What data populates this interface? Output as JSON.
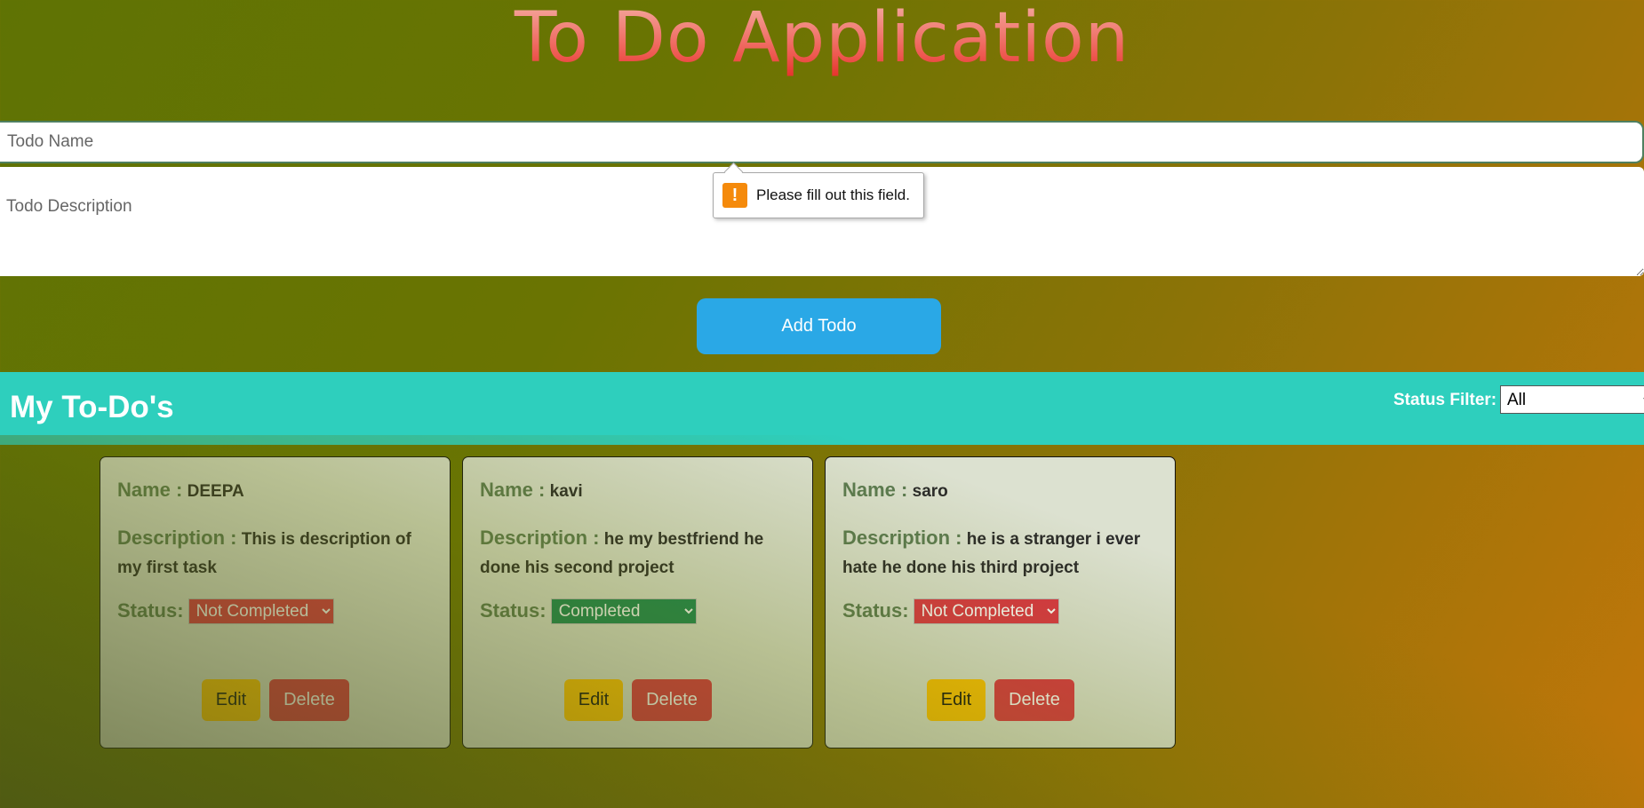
{
  "app": {
    "title": "To Do Application"
  },
  "form": {
    "name_placeholder": "Todo Name",
    "description_placeholder": "Todo Description",
    "add_button_label": "Add Todo",
    "validation_message": "Please fill out this field."
  },
  "list": {
    "title": "My To-Do's",
    "filter_label": "Status Filter:",
    "filter_value": "All"
  },
  "card_labels": {
    "name": "Name :",
    "description": "Description :",
    "status": "Status:",
    "edit": "Edit",
    "delete": "Delete"
  },
  "todos": [
    {
      "name": "DEEPA",
      "description": "This is description of my first task",
      "status": "Not Completed"
    },
    {
      "name": "kavi",
      "description": "he my bestfriend he done his second project",
      "status": "Completed"
    },
    {
      "name": "saro",
      "description": "he is a stranger i ever hate he done his third project",
      "status": "Not Completed"
    }
  ],
  "colors": {
    "not_completed": "#dc3545",
    "completed": "#198754",
    "header": "#2ecfbd",
    "add_button": "#2aa8e6"
  }
}
